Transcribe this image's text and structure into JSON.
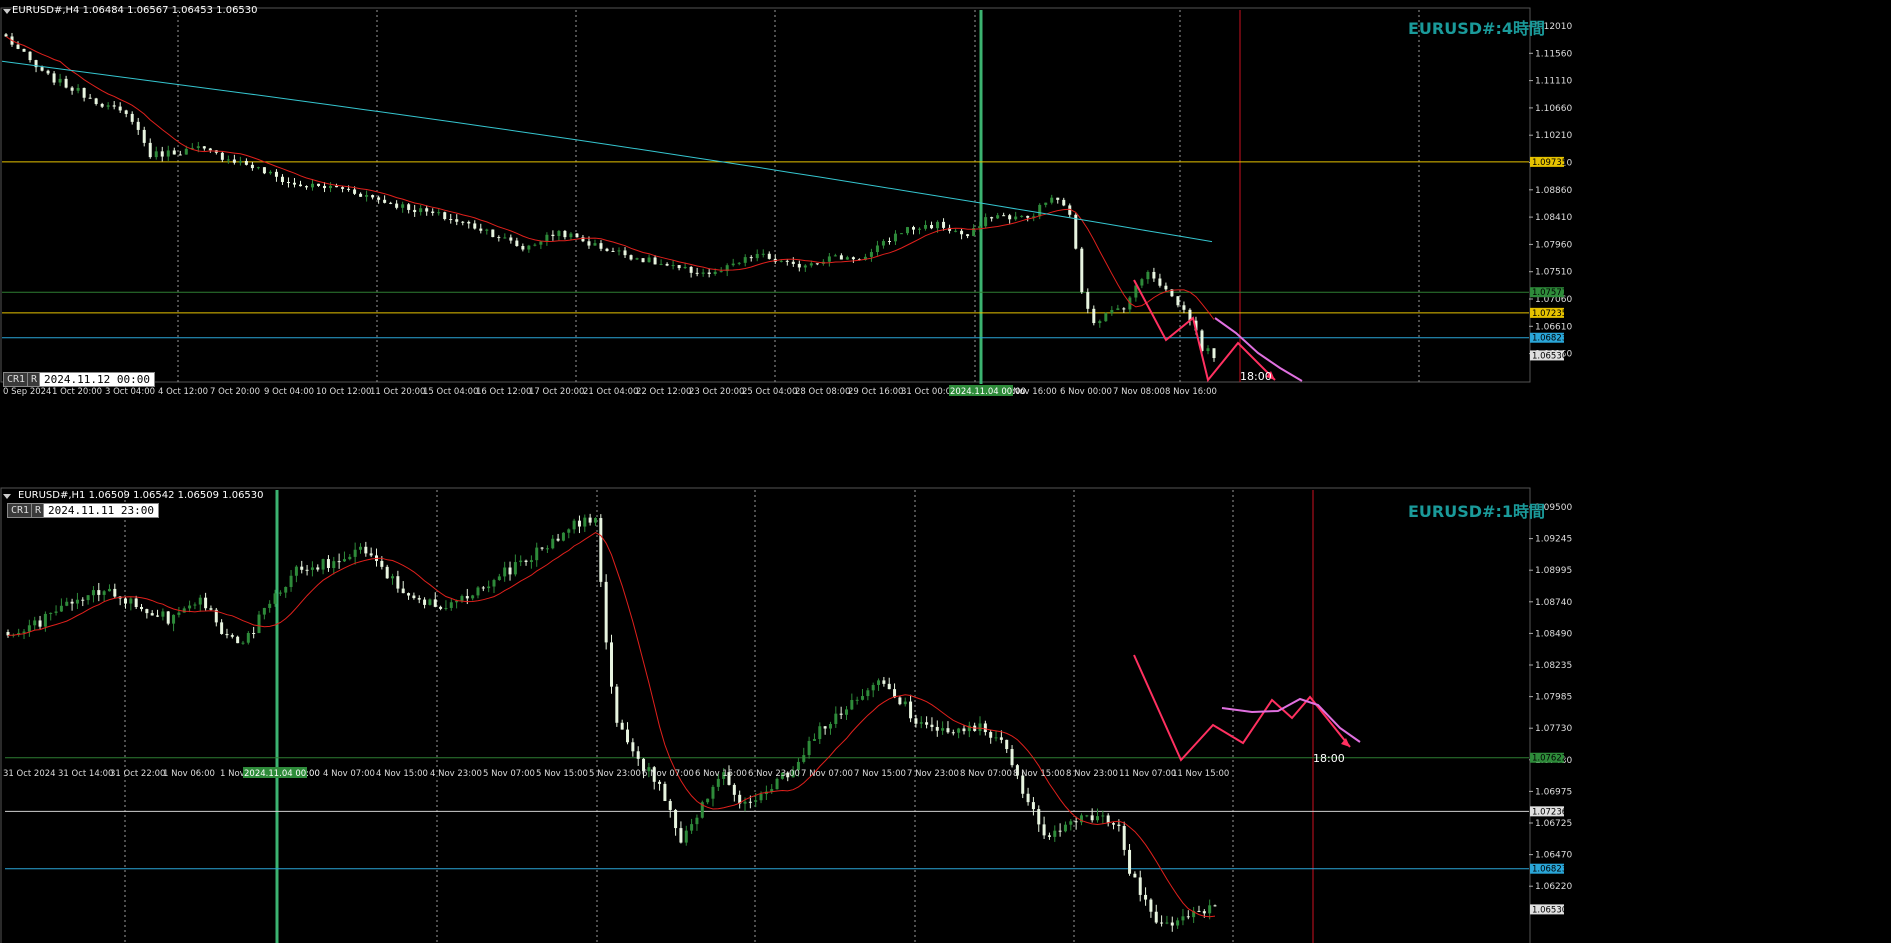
{
  "colors": {
    "bull": "#2e8b3a",
    "bear": "#e8f5e0",
    "ma_red": "#e0201c",
    "ma_cyan": "#35c5cf",
    "yellow": "#e6c200",
    "green_line": "#2e7d32",
    "blue_line": "#2aa6d8",
    "white_line": "#d0d0d0",
    "zigzag": "#ff3060",
    "forecast": "#e070e0",
    "vline_red": "#cc1020",
    "vline_green": "#3cb371"
  },
  "top": {
    "symbol_line": "EURUSD#,H4  1.06484 1.06567 1.06453 1.06530",
    "watermark": "EURUSD#:4時間",
    "cr_label": "CR1",
    "r_label": "R",
    "date_box": "2024.11.12 00:00",
    "time_marker": "18:00",
    "price_ticks": [
      "1.12010",
      "1.11560",
      "1.11110",
      "1.10660",
      "1.10210",
      "1.09310",
      "1.08860",
      "1.08410",
      "1.07960",
      "1.07510",
      "1.07060",
      "1.06610",
      "1.06160"
    ],
    "price_tags": [
      {
        "label": "1.09735",
        "type": "yellow"
      },
      {
        "label": "1.07577",
        "type": "green"
      },
      {
        "label": "1.07235",
        "type": "yellow"
      },
      {
        "label": "1.06823",
        "type": "blue"
      },
      {
        "label": "1.06530",
        "type": "current"
      }
    ],
    "time_labels": [
      "0 Sep 2024",
      "1 Oct 20:00",
      "3 Oct 04:00",
      "4 Oct 12:00",
      "7 Oct 20:00",
      "9 Oct 04:00",
      "10 Oct 12:00",
      "11 Oct 20:00",
      "15 Oct 04:00",
      "16 Oct 12:00",
      "17 Oct 20:00",
      "21 Oct 04:00",
      "22 Oct 12:00",
      "23 Oct 20:00",
      "25 Oct 04:00",
      "28 Oct 08:00",
      "29 Oct 16:00",
      "31 Oct 00:00",
      "Nov 16:00",
      "6 Nov 00:00",
      "7 Nov 08:00",
      "8 Nov 16:00"
    ],
    "hl_time": "2024.11.04 00:00"
  },
  "bottom": {
    "symbol_line": "EURUSD#,H1  1.06509 1.06542 1.06509 1.06530",
    "watermark": "EURUSD#:1時間",
    "cr_label": "CR1",
    "r_label": "R",
    "date_box": "2024.11.11 23:00",
    "time_marker": "18:00",
    "price_ticks": [
      "1.09500",
      "1.09245",
      "1.08995",
      "1.08740",
      "1.08490",
      "1.08235",
      "1.07985",
      "1.07730",
      "1.07480",
      "1.06975",
      "1.06725",
      "1.06470",
      "1.06220"
    ],
    "price_tags": [
      {
        "label": "1.07622",
        "type": "green"
      },
      {
        "label": "1.07236",
        "type": "white"
      },
      {
        "label": "1.06823",
        "type": "blue"
      },
      {
        "label": "1.06530",
        "type": "current"
      }
    ],
    "time_labels": [
      "31 Oct 2024",
      "31 Oct 14:00",
      "31 Oct 22:00",
      "1 Nov 06:00",
      "1 Nov",
      "4 Nov 07:00",
      "4 Nov 15:00",
      "4 Nov 23:00",
      "5 Nov 07:00",
      "5 Nov 15:00",
      "5 Nov 23:00",
      "6 Nov 07:00",
      "6 Nov 15:00",
      "6 Nov 23:00",
      "7 Nov 07:00",
      "7 Nov 15:00",
      "7 Nov 23:00",
      "8 Nov 07:00",
      "8 Nov 15:00",
      "8 Nov 23:00",
      "11 Nov 07:00",
      "11 Nov 15:00"
    ],
    "hl_time": "2024.11.04 00:00"
  },
  "chart_data": [
    {
      "type": "candlestick",
      "title": "EURUSD#,H4",
      "ylim": [
        1.0609,
        1.1225
      ],
      "hlines": [
        {
          "y": 1.09735,
          "color": "yellow"
        },
        {
          "y": 1.07577,
          "color": "green"
        },
        {
          "y": 1.07235,
          "color": "yellow"
        },
        {
          "y": 1.06823,
          "color": "blue"
        }
      ],
      "anchors": [
        [
          0,
          1.118
        ],
        [
          6,
          1.112
        ],
        [
          14,
          1.108
        ],
        [
          21,
          1.1045
        ],
        [
          24,
          1.0985
        ],
        [
          32,
          1.0995
        ],
        [
          40,
          1.097
        ],
        [
          48,
          1.0935
        ],
        [
          56,
          1.093
        ],
        [
          64,
          1.0905
        ],
        [
          72,
          1.0885
        ],
        [
          80,
          1.086
        ],
        [
          86,
          1.083
        ],
        [
          92,
          1.0858
        ],
        [
          98,
          1.0835
        ],
        [
          105,
          1.0815
        ],
        [
          112,
          1.0795
        ],
        [
          118,
          1.0788
        ],
        [
          125,
          1.082
        ],
        [
          131,
          1.08
        ],
        [
          137,
          1.0815
        ],
        [
          143,
          1.0815
        ],
        [
          149,
          1.086
        ],
        [
          155,
          1.087
        ],
        [
          160,
          1.085
        ],
        [
          164,
          1.0885
        ],
        [
          170,
          1.088
        ],
        [
          174,
          1.0915
        ],
        [
          177,
          1.089
        ],
        [
          179,
          1.076
        ],
        [
          181,
          1.071
        ],
        [
          186,
          1.0735
        ],
        [
          190,
          1.0795
        ],
        [
          194,
          1.075
        ],
        [
          197,
          1.0715
        ],
        [
          199,
          1.0665
        ],
        [
          201,
          1.0653
        ]
      ],
      "zigzag": [
        [
          1134,
          280
        ],
        [
          1166,
          340
        ],
        [
          1193,
          318
        ],
        [
          1208,
          380
        ],
        [
          1238,
          343
        ],
        [
          1275,
          380
        ]
      ],
      "forecast": [
        [
          1215,
          318
        ],
        [
          1236,
          333
        ],
        [
          1258,
          353
        ],
        [
          1280,
          368
        ],
        [
          1302,
          381
        ]
      ]
    },
    {
      "type": "candlestick",
      "title": "EURUSD#,H1",
      "ylim": [
        1.0618,
        1.0955
      ],
      "hlines": [
        {
          "y": 1.07622,
          "color": "green"
        },
        {
          "y": 1.07236,
          "color": "white"
        },
        {
          "y": 1.06823,
          "color": "blue"
        }
      ],
      "anchors": [
        [
          0,
          1.0848
        ],
        [
          6,
          1.086
        ],
        [
          12,
          1.0875
        ],
        [
          18,
          1.0882
        ],
        [
          24,
          1.0872
        ],
        [
          30,
          1.0862
        ],
        [
          36,
          1.0878
        ],
        [
          40,
          1.0852
        ],
        [
          44,
          1.0842
        ],
        [
          48,
          1.0868
        ],
        [
          54,
          1.0898
        ],
        [
          60,
          1.0902
        ],
        [
          66,
          1.0912
        ],
        [
          70,
          1.0898
        ],
        [
          76,
          1.0878
        ],
        [
          82,
          1.0872
        ],
        [
          88,
          1.0882
        ],
        [
          94,
          1.0898
        ],
        [
          100,
          1.0912
        ],
        [
          106,
          1.093
        ],
        [
          110,
          1.0935
        ],
        [
          112,
          1.0845
        ],
        [
          114,
          1.0785
        ],
        [
          118,
          1.076
        ],
        [
          122,
          1.0745
        ],
        [
          126,
          1.07
        ],
        [
          130,
          1.0728
        ],
        [
          134,
          1.0748
        ],
        [
          138,
          1.0728
        ],
        [
          142,
          1.0735
        ],
        [
          146,
          1.0752
        ],
        [
          150,
          1.0772
        ],
        [
          154,
          1.079
        ],
        [
          158,
          1.08
        ],
        [
          162,
          1.0818
        ],
        [
          166,
          1.0808
        ],
        [
          170,
          1.079
        ],
        [
          174,
          1.0782
        ],
        [
          178,
          1.078
        ],
        [
          182,
          1.0785
        ],
        [
          186,
          1.0775
        ],
        [
          190,
          1.074
        ],
        [
          194,
          1.0705
        ],
        [
          198,
          1.0712
        ],
        [
          204,
          1.0722
        ],
        [
          208,
          1.0715
        ],
        [
          210,
          1.0682
        ],
        [
          214,
          1.065
        ],
        [
          218,
          1.064
        ],
        [
          222,
          1.0652
        ],
        [
          226,
          1.0653
        ]
      ],
      "zigzag": [
        [
          1134,
          655
        ],
        [
          1181,
          760
        ],
        [
          1213,
          725
        ],
        [
          1243,
          743
        ],
        [
          1272,
          700
        ],
        [
          1292,
          718
        ],
        [
          1310,
          697
        ],
        [
          1350,
          747
        ]
      ],
      "forecast": [
        [
          1222,
          708
        ],
        [
          1252,
          712
        ],
        [
          1278,
          711
        ],
        [
          1300,
          699
        ],
        [
          1318,
          705
        ],
        [
          1340,
          728
        ],
        [
          1360,
          742
        ]
      ]
    }
  ]
}
